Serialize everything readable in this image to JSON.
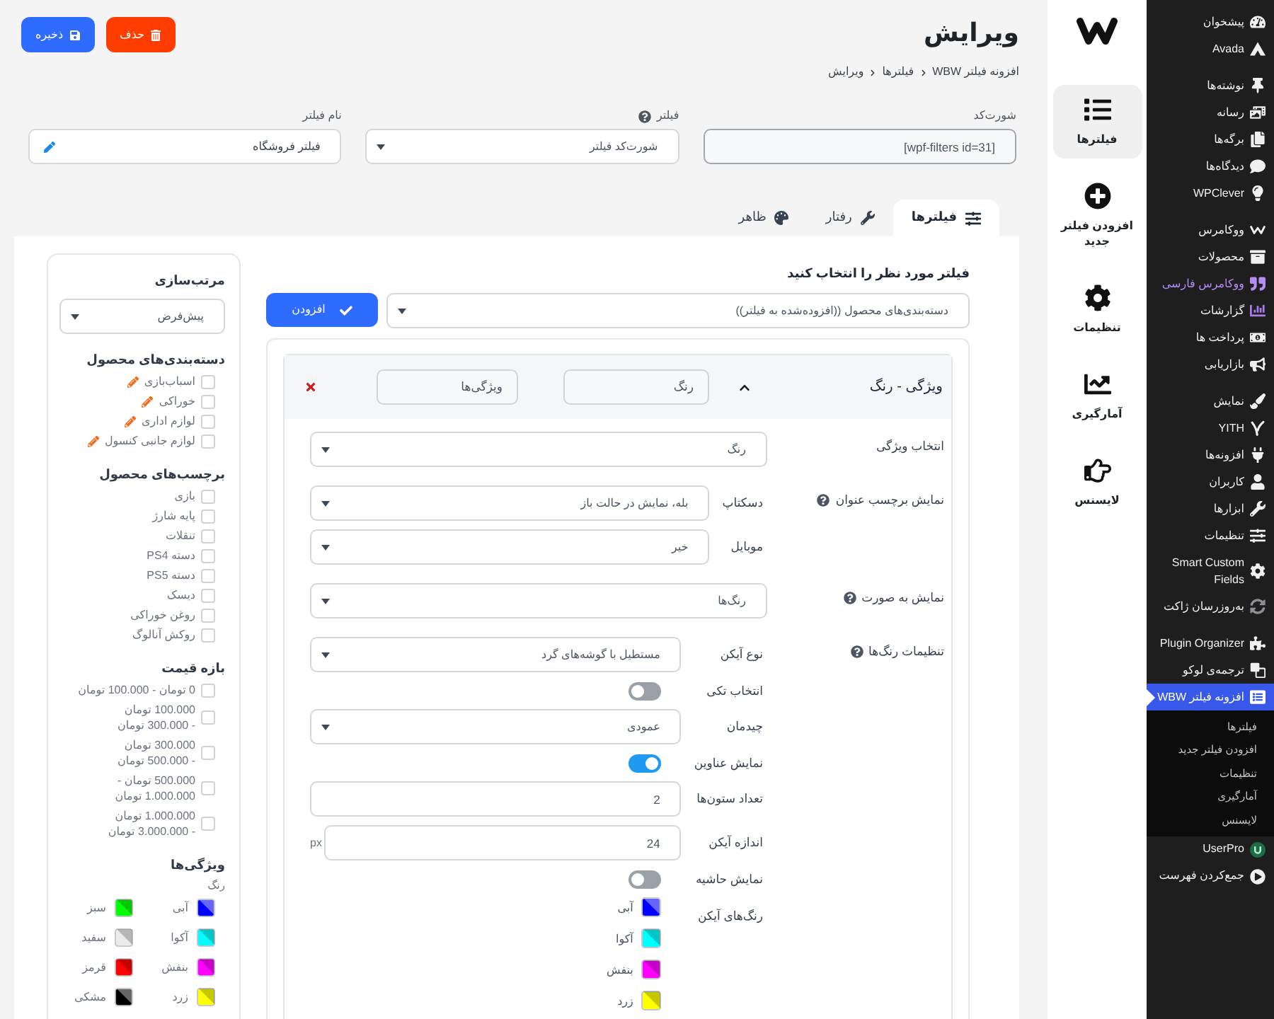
{
  "admin_menu": {
    "groups": [
      {
        "items": [
          {
            "label": "پیشخوان",
            "selected": false
          },
          {
            "label": "Avada",
            "selected": false
          }
        ]
      },
      {
        "items": [
          {
            "label": "نوشته‌ها",
            "selected": false
          },
          {
            "label": "رسانه",
            "selected": false
          },
          {
            "label": "برگه‌ها",
            "selected": false
          },
          {
            "label": "دیدگاه‌ها",
            "selected": false
          },
          {
            "label": "WPClever",
            "selected": false
          }
        ]
      },
      {
        "items": [
          {
            "label": "ووکامرس",
            "selected": false
          },
          {
            "label": "محصولات",
            "selected": false
          },
          {
            "label": "ووکامرس فارسی",
            "selected": false,
            "color": "#b48cf5"
          },
          {
            "label": "گزارشات",
            "selected": false
          },
          {
            "label": "پرداخت ها",
            "selected": false
          },
          {
            "label": "بازاریابی",
            "selected": false
          }
        ]
      },
      {
        "items": [
          {
            "label": "نمایش",
            "selected": false
          },
          {
            "label": "YITH",
            "selected": false
          },
          {
            "label": "افزونه‌ها",
            "selected": false
          },
          {
            "label": "کاربران",
            "selected": false
          },
          {
            "label": "ابزارها",
            "selected": false
          },
          {
            "label": "تنظیمات",
            "selected": false
          },
          {
            "label": "Smart Custom Fields",
            "selected": false
          },
          {
            "label": "به‌روزرسان ژاکت",
            "selected": false
          }
        ]
      },
      {
        "items": [
          {
            "label": "Plugin Organizer",
            "selected": false
          },
          {
            "label": "ترجمه‌ی لوکو",
            "selected": false
          },
          {
            "label": "افزونه فیلتر WBW",
            "selected": true,
            "submenu": [
              {
                "label": "فیلترها",
                "selected": false
              },
              {
                "label": "افزودن فیلتر جدید",
                "selected": false
              },
              {
                "label": "تنظیمات",
                "selected": false
              },
              {
                "label": "آمارگیری",
                "selected": false
              },
              {
                "label": "لایسنس",
                "selected": false
              }
            ]
          },
          {
            "label": "UserPro",
            "selected": false
          },
          {
            "label": "جمع‌کردن فهرست",
            "selected": false
          }
        ]
      }
    ]
  },
  "plugin_nav": {
    "items": [
      {
        "label": "فیلترها",
        "selected": true
      },
      {
        "label": "افزودن فیلتر جدید",
        "selected": false
      },
      {
        "label": "تنظیمات",
        "selected": false
      },
      {
        "label": "آمارگیری",
        "selected": false
      },
      {
        "label": "لایسنس",
        "selected": false
      }
    ]
  },
  "header": {
    "title": "ویرایش",
    "breadcrumb": [
      "افزونه فیلتر WBW",
      "فیلترها",
      "ویرایش"
    ],
    "buttons": [
      {
        "kind": "delete",
        "label": "حذف"
      },
      {
        "kind": "save",
        "label": "ذخیره"
      }
    ]
  },
  "settings_fields": [
    {
      "kind": "text",
      "label": "شورت‌کد",
      "help": false,
      "value": "[wpf-filters id=31]"
    },
    {
      "kind": "select",
      "label": "فیلتر",
      "help": true,
      "value": "شورت‌کد فیلتر"
    },
    {
      "kind": "editable",
      "label": "نام فیلتر",
      "help": false,
      "value": "فیلتر فروشگاه"
    }
  ],
  "tabs": [
    {
      "label": "فیلترها",
      "selected": true
    },
    {
      "label": "رفتار",
      "selected": false
    },
    {
      "label": "ظاهر",
      "selected": false
    }
  ],
  "filter_picker": {
    "label": "فیلتر مورد نظر را انتخاب کنید",
    "value": "دسته‌بندی‌های محصول ((افزوده‌شده به فیلتر))",
    "button": "افزودن"
  },
  "filter_block": {
    "title": "ویژگی - رنگ",
    "expanded": true,
    "inputs": [
      "رنگ",
      "ویژگی‌ها"
    ],
    "rows": [
      {
        "kind": "select",
        "label": "انتخاب ویژگی",
        "help": false,
        "value": "رنگ"
      },
      {
        "kind": "group",
        "label": "نمایش برچسب عنوان",
        "help": true,
        "rows": [
          {
            "kind": "select",
            "label": "دسکتاپ",
            "value": "بله، نمایش در حالت باز"
          },
          {
            "kind": "select",
            "label": "موبایل",
            "value": "خیر"
          }
        ]
      },
      {
        "kind": "select",
        "label": "نمایش به صورت",
        "help": true,
        "value": "رنگ‌ها"
      },
      {
        "kind": "group",
        "label": "تنظیمات رنگ‌ها",
        "help": true,
        "rows": [
          {
            "kind": "select",
            "label": "نوع آیکن",
            "value": "مستطیل با گوشه‌های گرد"
          },
          {
            "kind": "toggle",
            "label": "انتخاب تکی",
            "on": false
          },
          {
            "kind": "select",
            "label": "چیدمان",
            "value": "عمودی"
          },
          {
            "kind": "toggle",
            "label": "نمایش عناوین",
            "on": true
          },
          {
            "kind": "input",
            "label": "تعداد ستون‌ها",
            "value": "2"
          },
          {
            "kind": "input",
            "label": "اندازه آیکن",
            "value": "24",
            "unit": "px"
          },
          {
            "kind": "toggle",
            "label": "نمایش حاشیه",
            "on": false
          },
          {
            "kind": "colors",
            "label": "رنگ‌های آیکن",
            "colors": [
              {
                "name": "آبی",
                "color": "#0000ff"
              },
              {
                "name": "آکوا",
                "color": "#00ffff"
              },
              {
                "name": "بنفش",
                "color": "#ff00ff"
              },
              {
                "name": "زرد",
                "color": "#ffff00"
              }
            ]
          }
        ]
      }
    ]
  },
  "preview": {
    "sections": [
      {
        "kind": "select",
        "title": "مرتب‌سازی",
        "value": "پیش‌فرض"
      },
      {
        "kind": "checklist",
        "title": "دسته‌بندی‌های محصول",
        "items": [
          {
            "label": "اسباب‌بازی",
            "checked": false,
            "editable": true
          },
          {
            "label": "خوراکی",
            "checked": false,
            "editable": true
          },
          {
            "label": "لوازم اداری",
            "checked": false,
            "editable": true
          },
          {
            "label": "لوازم جانبی کنسول",
            "checked": false,
            "editable": true
          }
        ]
      },
      {
        "kind": "checklist",
        "title": "برچسب‌های محصول",
        "items": [
          {
            "label": "بازی",
            "checked": false,
            "editable": false
          },
          {
            "label": "پایه شارژ",
            "checked": false,
            "editable": false
          },
          {
            "label": "تنقلات",
            "checked": false,
            "editable": false
          },
          {
            "label": "دسته PS4",
            "checked": false,
            "editable": false
          },
          {
            "label": "دسته PS5",
            "checked": false,
            "editable": false
          },
          {
            "label": "دیسک",
            "checked": false,
            "editable": false
          },
          {
            "label": "روغن خوراکی",
            "checked": false,
            "editable": false
          },
          {
            "label": "روکش آنالوگ",
            "checked": false,
            "editable": false
          }
        ]
      },
      {
        "kind": "checklist",
        "title": "بازه قیمت",
        "items": [
          {
            "label": "0 تومان - 100.000 تومان",
            "checked": false,
            "editable": false
          },
          {
            "label": "100.000 تومان - 300.000 تومان",
            "checked": false,
            "editable": false
          },
          {
            "label": "300.000 تومان - 500.000 تومان",
            "checked": false,
            "editable": false
          },
          {
            "label": "500.000 تومان - 1.000.000 تومان",
            "checked": false,
            "editable": false
          },
          {
            "label": "1.000.000 تومان - 3.000.000 تومان",
            "checked": false,
            "editable": false
          }
        ]
      },
      {
        "kind": "colors",
        "title": "ویژگی‌ها",
        "subtitle": "رنگ",
        "colors": [
          {
            "name": "آبی",
            "color": "#0000ff"
          },
          {
            "name": "سبز",
            "color": "#00ff00"
          },
          {
            "name": "آکوا",
            "color": "#00ffff"
          },
          {
            "name": "سفید",
            "color": "#ebebeb"
          },
          {
            "name": "بنفش",
            "color": "#ff00ff"
          },
          {
            "name": "قرمز",
            "color": "#ff0000"
          },
          {
            "name": "زرد",
            "color": "#ffff00"
          },
          {
            "name": "مشکی",
            "color": "#000000"
          }
        ]
      }
    ]
  }
}
